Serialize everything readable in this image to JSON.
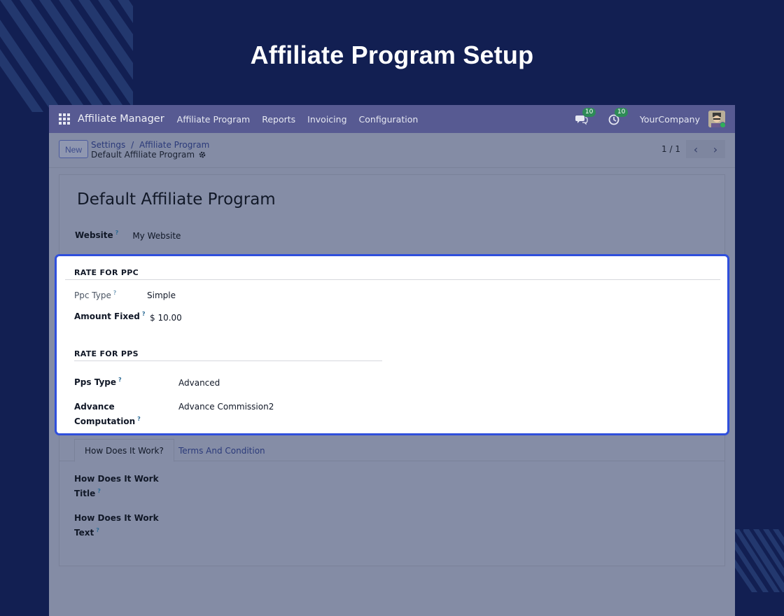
{
  "hero": {
    "title": "Affiliate Program Setup"
  },
  "topbar": {
    "brand": "Affiliate Manager",
    "menu": [
      "Affiliate Program",
      "Reports",
      "Invoicing",
      "Configuration"
    ],
    "messages_count": "10",
    "activities_count": "10",
    "company": "YourCompany"
  },
  "controlbar": {
    "new_label": "New",
    "breadcrumb": {
      "parent": "Settings",
      "sep": "/",
      "section": "Affiliate Program",
      "current": "Default Affiliate Program"
    },
    "pager": "1 / 1"
  },
  "record": {
    "title": "Default Affiliate Program",
    "website_label": "Website",
    "website_value": "My Website",
    "help_mark": "?"
  },
  "ppc": {
    "heading": "RATE FOR PPC",
    "type_label": "Ppc Type",
    "type_value": "Simple",
    "amount_label": "Amount Fixed",
    "amount_value": "$ 10.00"
  },
  "pps": {
    "heading": "RATE FOR PPS",
    "type_label": "Pps Type",
    "type_value": "Advanced",
    "advance_label_1": "Advance",
    "advance_label_2": "Computation",
    "advance_value": "Advance Commission2"
  },
  "tabs": {
    "active": "How Does It Work?",
    "inactive": "Terms And Condition"
  },
  "how": {
    "title_label_1": "How Does It Work",
    "title_label_2": "Title",
    "text_label_1": "How Does It Work",
    "text_label_2": "Text"
  },
  "colors": {
    "background": "#121f52",
    "topbar": "#575a92",
    "highlight_border": "#2f4fdc",
    "badge": "#2e8b57"
  }
}
